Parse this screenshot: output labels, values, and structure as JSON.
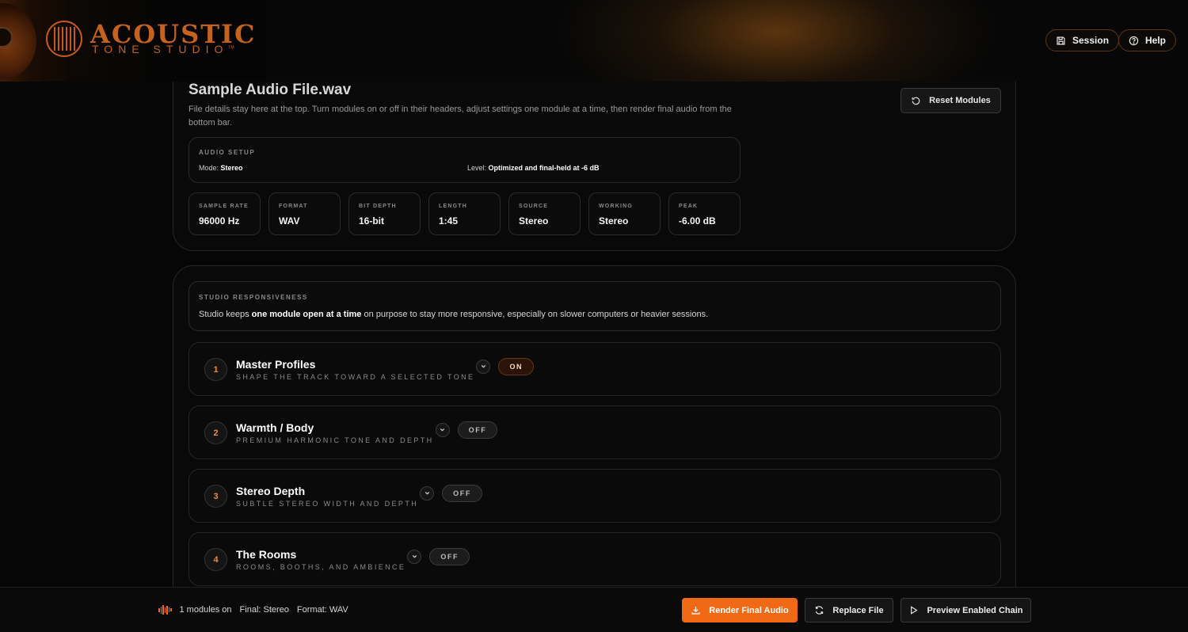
{
  "header": {
    "brand_name": "ACOUSTIC",
    "brand_sub": "TONE STUDIO",
    "trademark": "TM",
    "session_label": "Session",
    "help_label": "Help"
  },
  "file": {
    "title": "Sample Audio File.wav",
    "description": "File details stay here at the top. Turn modules on or off in their headers, adjust settings one module at a time, then render final audio from the bottom bar.",
    "reset_label": "Reset Modules",
    "setup": {
      "title": "AUDIO SETUP",
      "mode_label": "Mode:",
      "mode_value": "Stereo",
      "level_label": "Level:",
      "level_value": "Optimized and final-held at -6 dB"
    },
    "stats": [
      {
        "label": "SAMPLE RATE",
        "value": "96000 Hz"
      },
      {
        "label": "FORMAT",
        "value": "WAV"
      },
      {
        "label": "BIT DEPTH",
        "value": "16-bit"
      },
      {
        "label": "LENGTH",
        "value": "1:45"
      },
      {
        "label": "SOURCE",
        "value": "Stereo"
      },
      {
        "label": "WORKING",
        "value": "Stereo"
      },
      {
        "label": "PEAK",
        "value": "-6.00 dB"
      }
    ]
  },
  "responsiveness": {
    "title": "STUDIO RESPONSIVENESS",
    "text_before": "Studio keeps ",
    "text_bold": "one module open at a time",
    "text_after": " on purpose to stay more responsive, especially on slower computers or heavier sessions."
  },
  "modules": [
    {
      "number": "1",
      "title": "Master Profiles",
      "subtitle": "SHAPE THE TRACK TOWARD A SELECTED TONE",
      "state": "ON"
    },
    {
      "number": "2",
      "title": "Warmth / Body",
      "subtitle": "PREMIUM HARMONIC TONE AND DEPTH",
      "state": "OFF"
    },
    {
      "number": "3",
      "title": "Stereo Depth",
      "subtitle": "SUBTLE STEREO WIDTH AND DEPTH",
      "state": "OFF"
    },
    {
      "number": "4",
      "title": "The Rooms",
      "subtitle": "ROOMS, BOOTHS, AND AMBIENCE",
      "state": "OFF"
    }
  ],
  "bottom_bar": {
    "modules_on": "1 modules on",
    "final": "Final: Stereo",
    "format": "Format: WAV",
    "render_label": "Render Final Audio",
    "replace_label": "Replace File",
    "preview_label": "Preview Enabled Chain"
  },
  "colors": {
    "accent": "#f06a16",
    "brand": "#c4621e",
    "background": "#060606"
  }
}
